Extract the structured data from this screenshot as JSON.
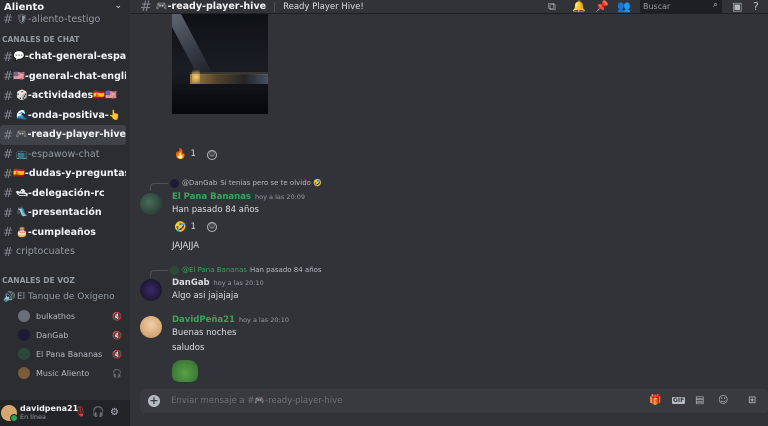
{
  "server": {
    "name": "Aliento"
  },
  "sidebar": {
    "top_channel": "🛡-aliento-testigo",
    "category_chat": "CANALES DE CHAT",
    "channels": [
      {
        "label": "💬-chat-general-español",
        "state": "unread"
      },
      {
        "label": "🇺🇸-general-chat-english",
        "state": "unread"
      },
      {
        "label": "🎲-actividades🇪🇸🇺🇸",
        "state": "unread"
      },
      {
        "label": "🌊-onda-positiva-👆",
        "state": "unread"
      },
      {
        "label": "🎮-ready-player-hive",
        "state": "active"
      },
      {
        "label": "📺-espawow-chat",
        "state": "muted"
      },
      {
        "label": "🇪🇸-dudas-y-preguntas",
        "state": "unread"
      },
      {
        "label": "🛥-delegación-rc",
        "state": "unread"
      },
      {
        "label": "🛝-presentación",
        "state": "unread"
      },
      {
        "label": "🎂-cumpleaños",
        "state": "unread"
      },
      {
        "label": "criptocuates",
        "state": "muted"
      }
    ],
    "category_voice": "CANALES DE VOZ",
    "voice_channel": "El Tanque de Oxígeno",
    "voice_users": [
      {
        "name": "bulkathos",
        "color": "#6a6f7a"
      },
      {
        "name": "DanGab",
        "color": "#1e1b3a"
      },
      {
        "name": "El Pana Bananas",
        "color": "#2c4a3a"
      },
      {
        "name": "Music Aliento",
        "color": "#7a5a3a"
      }
    ]
  },
  "user_panel": {
    "name": "davidpena21",
    "status": "En línea"
  },
  "topbar": {
    "channel": "🎮-ready-player-hive",
    "topic": "Ready Player Hive!",
    "search_placeholder": "Buscar"
  },
  "messages": {
    "r1": {
      "count": "1",
      "emoji": "🔥"
    },
    "m1": {
      "reply_user": "@DanGab",
      "reply_text": "Si tenias pero se te olvido 🤣",
      "author": "El Pana Bananas",
      "author_color": "#3ba55c",
      "time": "hoy a las 20:09",
      "text": "Han pasado 84 años",
      "reaction_emoji": "🤣",
      "reaction_count": "1",
      "text2": "JAJAJJA"
    },
    "m2": {
      "reply_user": "@El Pana Bananas",
      "reply_text": "Han pasado 84 años",
      "author": "DanGab",
      "author_color": "#dbdee1",
      "time": "hoy a las 20:10",
      "text": "Algo asi jajajaja"
    },
    "m3": {
      "author": "DavidPeña21",
      "author_color": "#3ba55c",
      "time": "hoy a las 20:10",
      "text": "Buenas noches",
      "text2": "saludos"
    }
  },
  "composer": {
    "placeholder": "Enviar mensaje a #🎮-ready-player-hive"
  }
}
